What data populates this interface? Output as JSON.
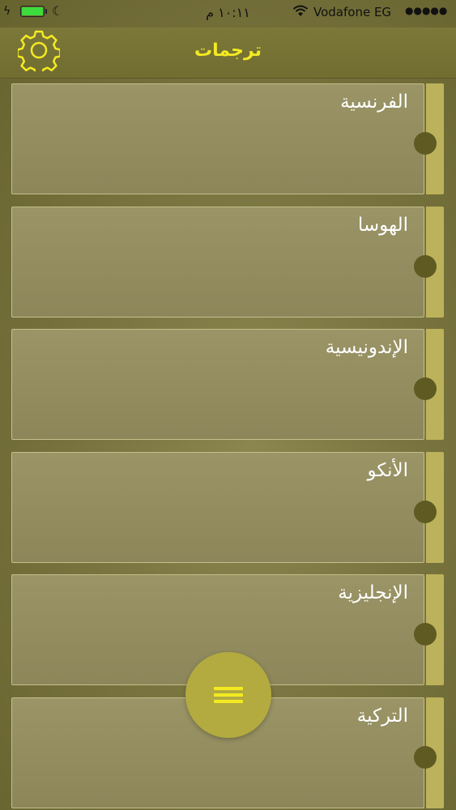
{
  "status_bar": {
    "time": "١٠:١١ م",
    "carrier": "Vodafone EG",
    "signal": "●●●●●",
    "battery_color": "#3ddc3d"
  },
  "nav": {
    "title": "ترجمات",
    "settings_icon": "gear-icon",
    "title_color": "#f3ea22"
  },
  "translations": [
    {
      "label": "الفرنسية"
    },
    {
      "label": "الهوسا"
    },
    {
      "label": "الإندونيسية"
    },
    {
      "label": "الأنكو"
    },
    {
      "label": "الإنجليزية"
    },
    {
      "label": "التركية"
    }
  ],
  "fab": {
    "icon": "menu-icon",
    "color": "#b3ab3f"
  }
}
